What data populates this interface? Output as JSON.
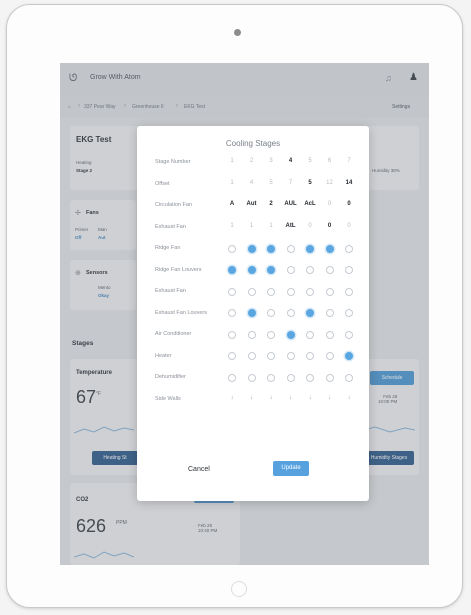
{
  "app": {
    "title": "Grow With Atom"
  },
  "breadcrumbs": [
    "337 Pear Way",
    "Greenhouse 6",
    "EKG Test"
  ],
  "settings_label": "Settings",
  "controller": {
    "name": "EKG Test",
    "heating_label": "Heating",
    "heating_value": "Stage 2",
    "humidity_label": "Humidity 38%"
  },
  "fans": {
    "title": "Fans",
    "col1_label": "Primer",
    "col1_value": "Off",
    "col2_label": "Man",
    "col2_value": "Aut"
  },
  "sensors": {
    "title": "Sensors",
    "label": "Mento",
    "value": "Okay"
  },
  "stages_title": "Stages",
  "temperature": {
    "title": "Temperature",
    "value": "67",
    "unit": "°F",
    "right_time": "Feb 28\n10:00 PM",
    "schedule_label": "Schedule"
  },
  "buttons": {
    "heating_stages": "Heating St",
    "humidity_stages": "Humidity Stages"
  },
  "co2": {
    "title": "CO2",
    "value": "626",
    "unit": "PPM",
    "time": "Feb 28\n10:40 PM"
  },
  "modal": {
    "title": "Cooling Stages",
    "columns": [
      "1",
      "2",
      "3",
      "4",
      "5",
      "6",
      "7"
    ],
    "rows": [
      {
        "label": "Stage Number",
        "type": "text",
        "cells": [
          "1",
          "2",
          "3",
          "4",
          "5",
          "6",
          "7"
        ],
        "on": [
          false,
          false,
          false,
          true,
          false,
          false,
          false
        ]
      },
      {
        "label": "Offset",
        "type": "text",
        "cells": [
          "1",
          "4",
          "5",
          "7",
          "5",
          "12",
          "14"
        ],
        "on": [
          false,
          false,
          false,
          false,
          true,
          false,
          true
        ]
      },
      {
        "label": "Circulation Fan",
        "type": "text",
        "cells": [
          "A",
          "Aut",
          "2",
          "AUL",
          "AcL",
          "0",
          "0"
        ],
        "on": [
          true,
          true,
          true,
          true,
          true,
          false,
          true
        ]
      },
      {
        "label": "Exhaust Fan",
        "type": "text",
        "cells": [
          "1",
          "1",
          "1",
          "AtL",
          "0",
          "0",
          "0"
        ],
        "on": [
          false,
          false,
          false,
          true,
          false,
          true,
          false
        ]
      },
      {
        "label": "Ridge Fan",
        "type": "circle",
        "on": [
          false,
          true,
          true,
          false,
          true,
          true,
          false
        ]
      },
      {
        "label": "Ridge Fan Louvers",
        "type": "circle",
        "on": [
          true,
          true,
          true,
          false,
          false,
          false,
          false
        ]
      },
      {
        "label": "Exhaust Fan",
        "type": "circle",
        "on": [
          false,
          false,
          false,
          false,
          false,
          false,
          false
        ]
      },
      {
        "label": "Exhaust Fan Louvers",
        "type": "circle",
        "on": [
          false,
          true,
          false,
          false,
          true,
          false,
          false
        ]
      },
      {
        "label": "Air Conditioner",
        "type": "circle",
        "on": [
          false,
          false,
          false,
          true,
          false,
          false,
          false
        ]
      },
      {
        "label": "Heater",
        "type": "circle",
        "on": [
          false,
          false,
          false,
          false,
          false,
          false,
          true
        ]
      },
      {
        "label": "Dehumidifier",
        "type": "circle",
        "on": [
          false,
          false,
          false,
          false,
          false,
          false,
          false
        ]
      },
      {
        "label": "Side Walls",
        "type": "arrow",
        "cells": [
          "↓",
          "↓",
          "↓",
          "↓",
          "↓",
          "↓",
          "↓"
        ]
      }
    ],
    "cancel_label": "Cancel",
    "update_label": "Update"
  }
}
